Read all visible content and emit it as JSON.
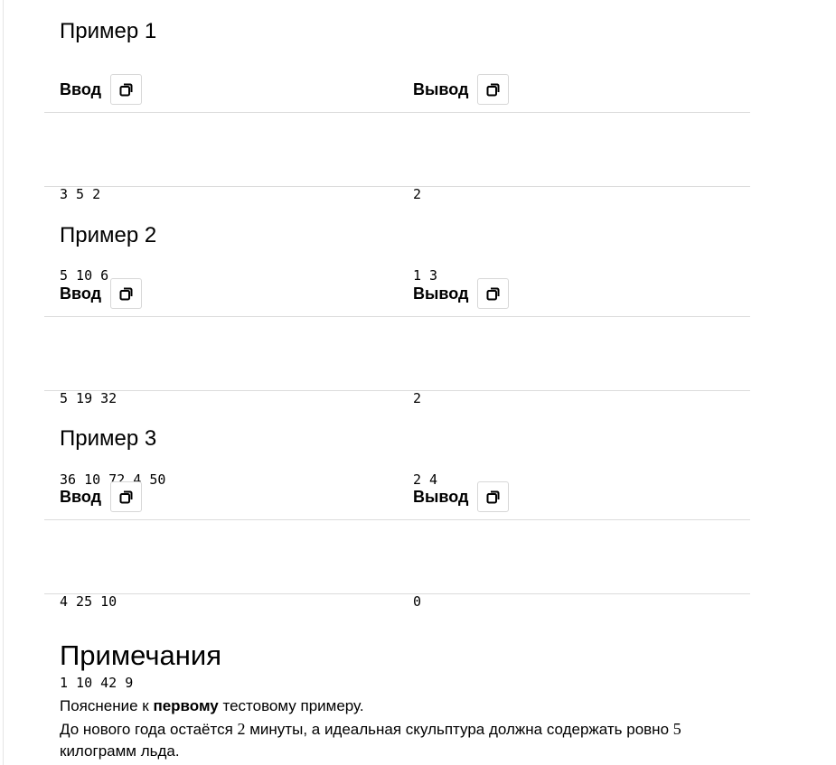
{
  "examples": [
    {
      "title": "Пример 1",
      "input_label": "Ввод",
      "output_label": "Вывод",
      "input_lines": [
        "3 5 2",
        "5 10 6"
      ],
      "output_lines": [
        "2",
        "1 3"
      ]
    },
    {
      "title": "Пример 2",
      "input_label": "Ввод",
      "output_label": "Вывод",
      "input_lines": [
        "5 19 32",
        "36 10 72 4 50"
      ],
      "output_lines": [
        "2",
        "2 4"
      ]
    },
    {
      "title": "Пример 3",
      "input_label": "Ввод",
      "output_label": "Вывод",
      "input_lines": [
        "4 25 10",
        "1 10 42 9"
      ],
      "output_lines": [
        "0"
      ]
    }
  ],
  "notes": {
    "title": "Примечания",
    "line1_before": "Пояснение к ",
    "line1_bold": "первому",
    "line1_after": " тестовому примеру.",
    "line2_part1": "До нового года остаётся ",
    "line2_num1": "2",
    "line2_part2": " минуты, а идеальная скульптура должна содержать ровно ",
    "line2_num2": "5",
    "line2_part3": " килограмм льда."
  }
}
